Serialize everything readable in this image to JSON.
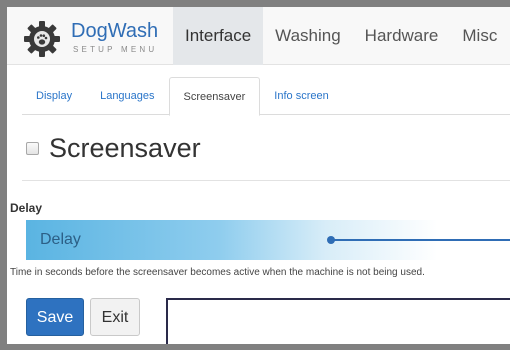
{
  "brand": {
    "name": "DogWash",
    "subtitle": "SETUP MENU"
  },
  "topnav": {
    "items": [
      {
        "label": "Interface",
        "active": true
      },
      {
        "label": "Washing",
        "active": false
      },
      {
        "label": "Hardware",
        "active": false
      },
      {
        "label": "Misc",
        "active": false
      }
    ]
  },
  "subtabs": {
    "items": [
      {
        "label": "Display",
        "active": false
      },
      {
        "label": "Languages",
        "active": false
      },
      {
        "label": "Screensaver",
        "active": true
      },
      {
        "label": "Info screen",
        "active": false
      }
    ]
  },
  "section": {
    "title": "Screensaver",
    "enabled": false
  },
  "delay": {
    "label": "Delay",
    "slider_text": "Delay",
    "help": "Time in seconds before the screensaver becomes active when the machine is not being used."
  },
  "buttons": {
    "save": "Save",
    "exit": "Exit"
  },
  "colors": {
    "accent": "#2f6db5",
    "slider_start": "#5ab4e2",
    "active_tab_bg": "#e4e7ea"
  },
  "icons": {
    "logo": "gear-paw-icon"
  }
}
